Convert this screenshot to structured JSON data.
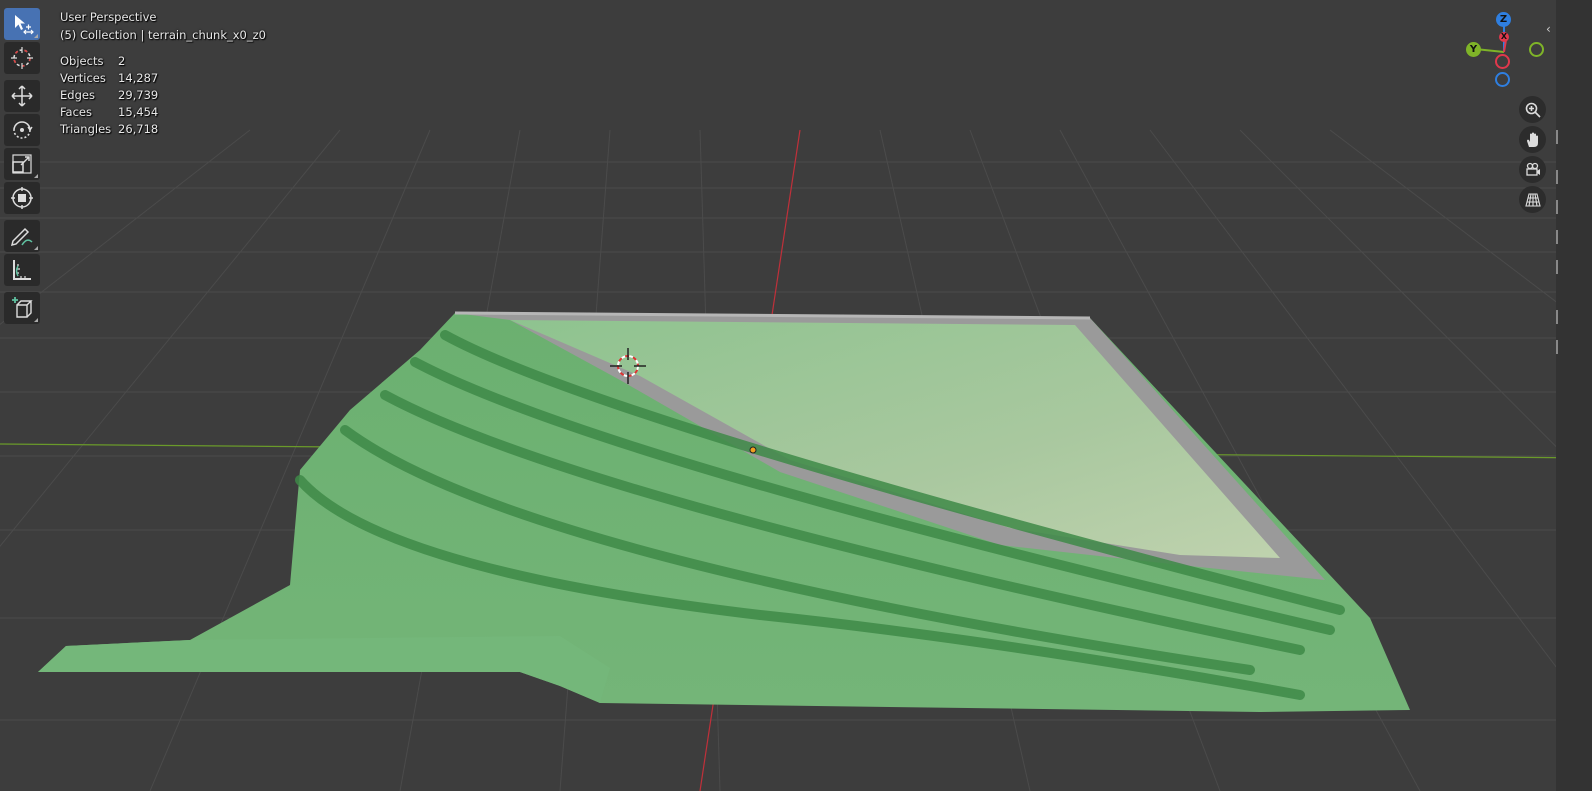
{
  "viewport": {
    "view_name": "User Perspective",
    "collection_label": "(5) Collection | terrain_chunk_x0_z0"
  },
  "stats": [
    {
      "label": "Objects",
      "value": "2"
    },
    {
      "label": "Vertices",
      "value": "14,287"
    },
    {
      "label": "Edges",
      "value": "29,739"
    },
    {
      "label": "Faces",
      "value": "15,454"
    },
    {
      "label": "Triangles",
      "value": "26,718"
    }
  ],
  "toolbar": {
    "tools": [
      {
        "name": "select-box-tool",
        "icon": "cursor-select-icon",
        "active": true
      },
      {
        "name": "cursor-tool",
        "icon": "3d-cursor-icon"
      },
      {
        "name": "move-tool",
        "icon": "move-arrows-icon"
      },
      {
        "name": "rotate-tool",
        "icon": "rotate-icon"
      },
      {
        "name": "scale-tool",
        "icon": "scale-icon"
      },
      {
        "name": "transform-tool",
        "icon": "transform-icon"
      },
      {
        "name": "annotate-tool",
        "icon": "annotate-pencil-icon"
      },
      {
        "name": "measure-tool",
        "icon": "measure-ruler-icon"
      },
      {
        "name": "add-cube-tool",
        "icon": "add-cube-icon"
      }
    ]
  },
  "gizmo": {
    "axes": [
      {
        "label": "Z",
        "color": "#2f7fe0"
      },
      {
        "label": "Y",
        "color": "#7fb428"
      },
      {
        "label": "X",
        "color": "#e0384c"
      }
    ]
  },
  "navigation": [
    {
      "name": "zoom-button",
      "icon": "magnifier-plus-icon"
    },
    {
      "name": "pan-button",
      "icon": "hand-icon"
    },
    {
      "name": "camera-view-button",
      "icon": "camera-icon"
    },
    {
      "name": "perspective-toggle-button",
      "icon": "grid-perspective-icon"
    }
  ],
  "colors": {
    "background": "#3d3d3d",
    "grid": "#4a4a4a",
    "x_axis": "#c0303a",
    "y_axis": "#6a9a2a",
    "terrain_green": "#5fa868",
    "road_gray": "#9a9a9a",
    "active_tool": "#4772b3"
  }
}
